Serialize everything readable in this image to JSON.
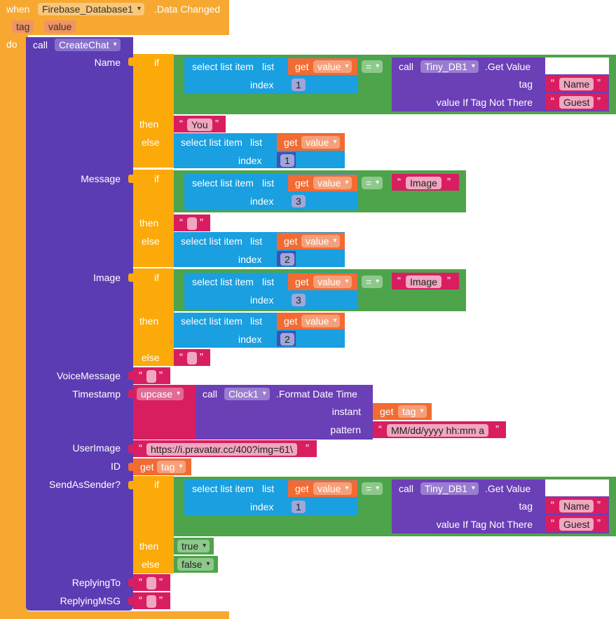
{
  "event": {
    "when": "when",
    "component": "Firebase_Database1",
    "event_name": ".Data Changed",
    "params": [
      "tag",
      "value"
    ],
    "do": "do"
  },
  "call_block": {
    "call": "call",
    "procedure": "CreateChat"
  },
  "sockets": {
    "name": "Name",
    "message": "Message",
    "image": "Image",
    "voice_message": "VoiceMessage",
    "timestamp": "Timestamp",
    "user_image": "UserImage",
    "id": "ID",
    "send_as_sender": "SendAsSender?",
    "replying_to": "ReplyingTo",
    "replying_msg": "ReplyingMSG"
  },
  "keywords": {
    "if": "if",
    "then": "then",
    "else": "else",
    "select_list_item": "select list item",
    "list": "list",
    "index": "index",
    "get": "get",
    "eq": "=",
    "call": "call",
    "get_value": ".Get Value",
    "tag": "tag",
    "value_if_tag_not_there": "value If Tag Not There",
    "upcase": "upcase",
    "format_date_time": ".Format Date Time",
    "instant": "instant",
    "pattern": "pattern",
    "open_quote": "“",
    "close_quote": "”"
  },
  "components": {
    "tinydb": "Tiny_DB1",
    "clock": "Clock1"
  },
  "variables": {
    "value": "value",
    "tag": "tag"
  },
  "numbers": {
    "n1": "1",
    "n2": "2",
    "n3": "3"
  },
  "strings": {
    "name": "Name",
    "guest": "Guest",
    "you": "You",
    "image": "Image",
    "pattern": "MM/dd/yyyy hh:mm a",
    "avatar_url": "https://i.pravatar.cc/400?img=61\\"
  },
  "booleans": {
    "true": "true",
    "false": "false"
  },
  "colors": {
    "event": "#f7a831",
    "procedure": "#5b3cb3",
    "control": "#fbaa0a",
    "lists": "#1a9fe0",
    "variables": "#f26b33",
    "logic": "#4ea44a",
    "text": "#d81e61",
    "math": "#3f51b5",
    "component": "#6b3fb6"
  }
}
